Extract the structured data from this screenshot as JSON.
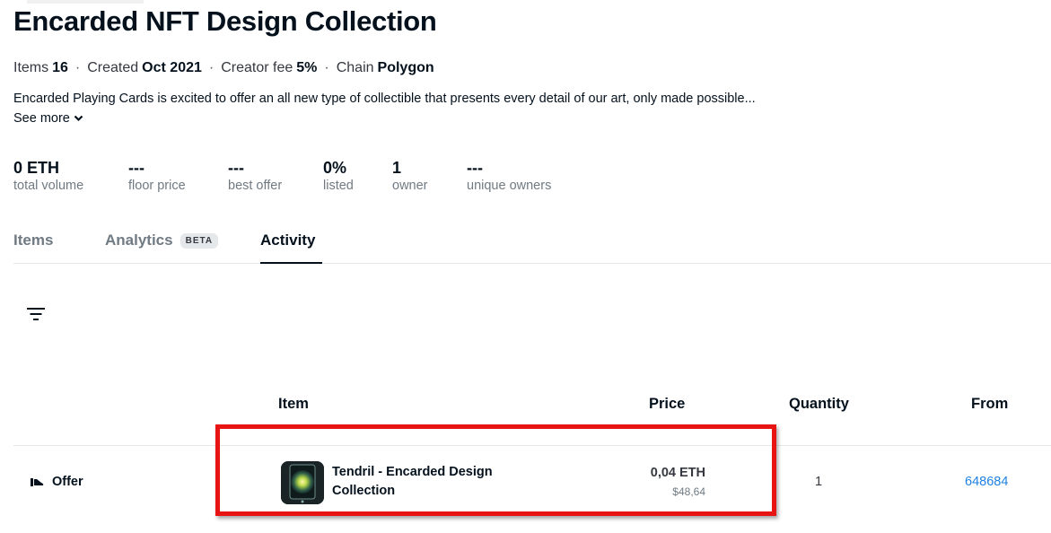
{
  "collection": {
    "title": "Encarded NFT Design Collection",
    "meta": [
      {
        "label": "Items",
        "value": "16"
      },
      {
        "label": "Created",
        "value": "Oct 2021"
      },
      {
        "label": "Creator fee",
        "value": "5%"
      },
      {
        "label": "Chain",
        "value": "Polygon"
      }
    ],
    "separator": "·",
    "description": "Encarded Playing Cards is excited to offer an all new type of collectible that presents every detail of our art, only made possible...",
    "see_more": "See more"
  },
  "stats": [
    {
      "value": "0 ETH",
      "label": "total volume"
    },
    {
      "value": "---",
      "label": "floor price"
    },
    {
      "value": "---",
      "label": "best offer"
    },
    {
      "value": "0%",
      "label": "listed"
    },
    {
      "value": "1",
      "label": "owner"
    },
    {
      "value": "---",
      "label": "unique owners"
    }
  ],
  "tabs": [
    {
      "label": "Items"
    },
    {
      "label": "Analytics",
      "badge": "BETA"
    },
    {
      "label": "Activity",
      "active": true
    }
  ],
  "table": {
    "headers": {
      "item": "Item",
      "price": "Price",
      "quantity": "Quantity",
      "from": "From"
    },
    "rows": [
      {
        "event": "Offer",
        "item_name": "Tendril - Encarded Design Collection",
        "price_eth": "0,04 ETH",
        "price_usd": "$48,64",
        "quantity": "1",
        "from": "648684"
      }
    ]
  },
  "colors": {
    "link": "#2081e2",
    "highlight": "#e81414",
    "text": "#04111d",
    "muted": "#707a83"
  }
}
